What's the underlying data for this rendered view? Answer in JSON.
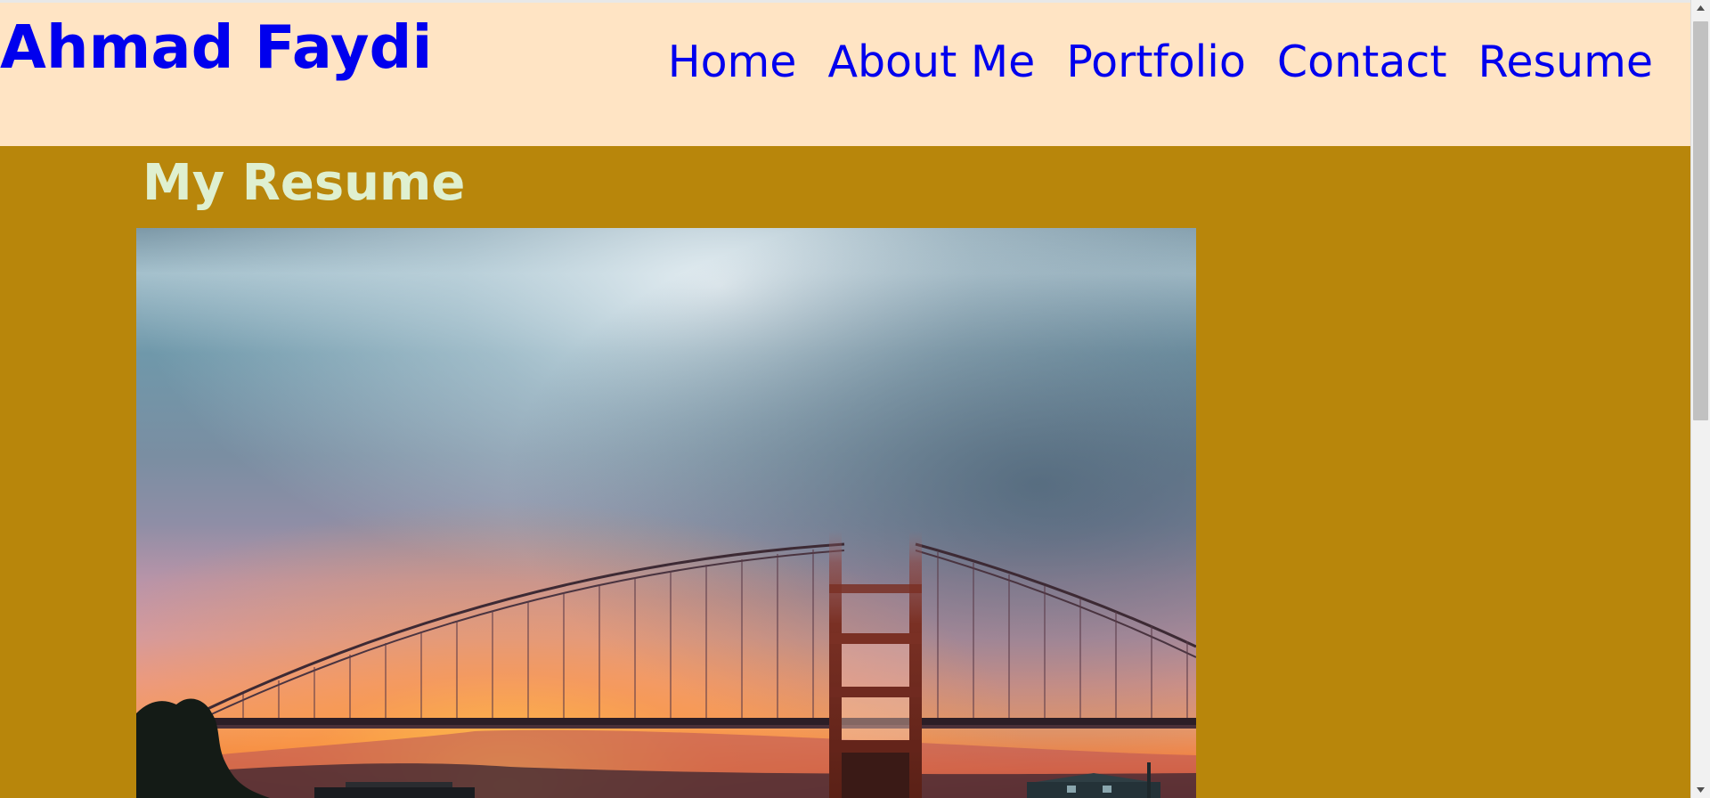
{
  "header": {
    "brand": "Ahmad Faydi",
    "nav": [
      {
        "label": "Home"
      },
      {
        "label": "About Me"
      },
      {
        "label": "Portfolio"
      },
      {
        "label": "Contact"
      },
      {
        "label": "Resume"
      }
    ]
  },
  "main": {
    "title": "My Resume",
    "image_subject": "Golden Gate Bridge in fog at sunset"
  },
  "colors": {
    "header_bg": "#ffe4c4",
    "page_bg": "#b8860b",
    "link": "#0000ee",
    "title": "#dff0d0"
  },
  "scrollbar": {
    "up_icon": "triangle-up-icon",
    "down_icon": "triangle-down-icon"
  }
}
